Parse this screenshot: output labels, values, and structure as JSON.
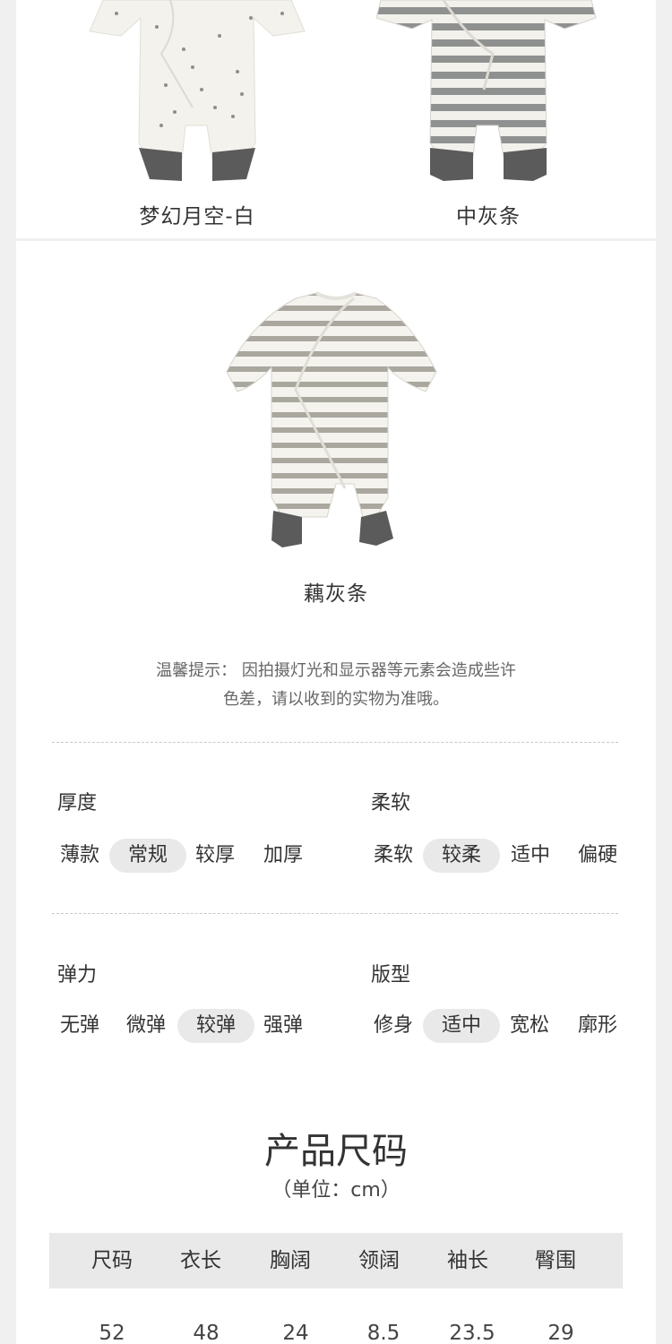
{
  "products": [
    {
      "caption": "梦幻月空-白"
    },
    {
      "caption": "中灰条"
    },
    {
      "caption": "藕灰条"
    }
  ],
  "tip": {
    "line1": "温馨提示：  因拍摄灯光和显示器等元素会造成些许",
    "line2": "色差，请以收到的实物为准哦。"
  },
  "attributes": [
    {
      "title": "厚度",
      "options": [
        "薄款",
        "常规",
        "较厚",
        "加厚"
      ],
      "selected": "常规"
    },
    {
      "title": "柔软",
      "options": [
        "柔软",
        "较柔",
        "适中",
        "偏硬"
      ],
      "selected": "较柔"
    },
    {
      "title": "弹力",
      "options": [
        "无弹",
        "微弹",
        "较弹",
        "强弹"
      ],
      "selected": "较弹"
    },
    {
      "title": "版型",
      "options": [
        "修身",
        "适中",
        "宽松",
        "廓形"
      ],
      "selected": "适中"
    }
  ],
  "size_chart": {
    "title": "产品尺码",
    "unit": "（单位：cm）",
    "headers": [
      "尺码",
      "衣长",
      "胸阔",
      "领阔",
      "袖长",
      "臀围"
    ],
    "rows": [
      [
        "52",
        "48",
        "24",
        "8.5",
        "23.5",
        "29"
      ]
    ]
  },
  "colors": {
    "background": "#f0f0f0",
    "card": "#ffffff",
    "selected_pill": "#e9e9e9",
    "stripe_gray": "#8f9090",
    "stripe_taupe": "#a9a79e",
    "foot_gray": "#5b5b5b"
  }
}
